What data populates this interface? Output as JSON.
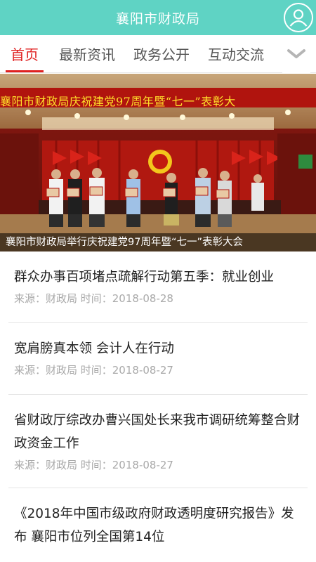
{
  "header": {
    "title": "襄阳市财政局",
    "user_icon": "user-avatar-icon"
  },
  "tabs": [
    {
      "label": "首页",
      "active": true
    },
    {
      "label": "最新资讯",
      "active": false
    },
    {
      "label": "政务公开",
      "active": false
    },
    {
      "label": "互动交流",
      "active": false
    }
  ],
  "more_icon": "chevron-down-icon",
  "banner": {
    "headline": "襄阳市财政局庆祝建党97周年暨“七一”表彰大",
    "caption": "襄阳市财政局举行庆祝建党97周年暨“七一”表彰大会"
  },
  "news": [
    {
      "title": "群众办事百项堵点疏解行动第五季：就业创业",
      "meta": "来源：财政局 时间：2018-08-28"
    },
    {
      "title": "宽肩膀真本领 会计人在行动",
      "meta": "来源：财政局 时间：2018-08-27"
    },
    {
      "title": "省财政厅综改办曹兴国处长来我市调研统筹整合财政资金工作",
      "meta": "来源：财政局 时间：2018-08-27"
    },
    {
      "title": "《2018年中国市级政府财政透明度研究报告》发布 襄阳市位列全国第14位",
      "meta": ""
    }
  ],
  "colors": {
    "header": "#5fd3c4",
    "active_tab": "#e02020",
    "meta_text": "#a9a9a9"
  }
}
